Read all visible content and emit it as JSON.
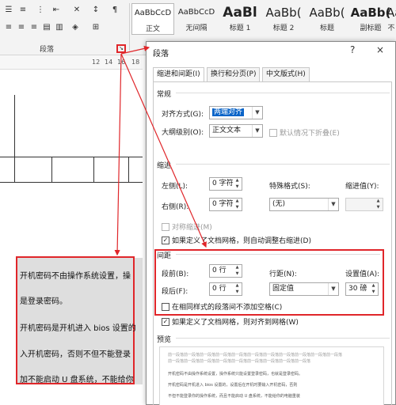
{
  "ribbon": {
    "group_label": "段落",
    "styles": [
      {
        "preview": "AaBbCcD",
        "label": "正文",
        "selected": true
      },
      {
        "preview": "AaBbCcD",
        "label": "无间隔",
        "selected": false
      },
      {
        "preview": "AaBl",
        "label": "标题 1",
        "selected": false
      },
      {
        "preview": "AaBb(",
        "label": "标题 2",
        "selected": false
      },
      {
        "preview": "AaBb(",
        "label": "标题",
        "selected": false
      },
      {
        "preview": "AaBb(",
        "label": "副标题",
        "selected": false
      },
      {
        "preview": "Aa",
        "label": "不",
        "selected": false
      }
    ],
    "dialog_launcher_icon": "dialog-launcher-icon"
  },
  "ruler": {
    "numbers": [
      "12",
      "14",
      "16",
      "18"
    ]
  },
  "document": {
    "lines": [
      "开机密码不由操作系统设置，操",
      "是登录密码。",
      "开机密码是开机进入 bios 设置的",
      "入开机密码，否则不但不能登录",
      "加不能启动 U 盘系统，不能给你"
    ]
  },
  "dialog": {
    "title": "段落",
    "help": "?",
    "close": "×",
    "tabs": [
      "缩进和间距(I)",
      "换行和分页(P)",
      "中文版式(H)"
    ],
    "general": {
      "heading": "常规",
      "alignment_label": "对齐方式(G):",
      "alignment_value": "两端对齐",
      "outline_label": "大纲级别(O):",
      "outline_value": "正文文本",
      "collapse_label": "默认情况下折叠(E)"
    },
    "indent": {
      "heading": "缩进",
      "left_label": "左侧(L):",
      "left_value": "0 字符",
      "right_label": "右侧(R):",
      "right_value": "0 字符",
      "special_label": "特殊格式(S):",
      "special_value": "(无)",
      "indent_by_label": "缩进值(Y):",
      "indent_by_value": "",
      "mirror_label": "对称缩进(M)",
      "auto_adjust_label": "如果定义了文档网格，则自动调整右缩进(D)"
    },
    "spacing": {
      "heading": "间距",
      "before_label": "段前(B):",
      "before_value": "0 行",
      "after_label": "段后(F):",
      "after_value": "0 行",
      "line_spacing_label": "行距(N):",
      "line_spacing_value": "固定值",
      "at_label": "设置值(A):",
      "at_value": "30 磅",
      "dont_add_label": "在相同样式的段落间不添加空格(C)",
      "snap_grid_label": "如果定义了文档网格，则对齐到网格(W)"
    },
    "preview": {
      "heading": "预览",
      "lines": [
        "前一段落前一段落前一段落前一段落前一段落前一段落前一段落前一段落前一段落前一段落前一段落",
        "前一段落前一段落前一段落前一段落前一段落前一段落前一段落前一段落前一段落",
        "开机密码不由操作系统设置，操作系统只能设置登录密码，也就是登录密码。",
        "开机密码是开机进入 bios 设置的，设置后在开机时要输入开机密码，否则",
        "不但不能登录你的操作系统，而且不能启动 U 盘系统，不能给你的电脑重装"
      ]
    }
  }
}
